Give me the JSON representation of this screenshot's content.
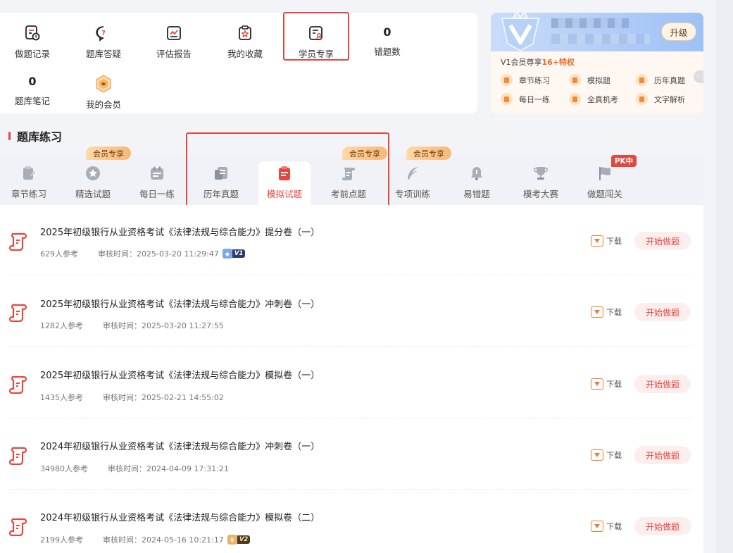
{
  "tools": {
    "wrong_records": "做题记录",
    "qa": "题库答疑",
    "report": "评估报告",
    "favorites": "我的收藏",
    "student_exclusive": "学员专享",
    "wrong_count_value": "0",
    "wrong_count_label": "错题数",
    "notes_count_value": "0",
    "notes_label": "题库笔记",
    "my_member": "我的会员"
  },
  "vip": {
    "upgrade": "升级",
    "title_prefix": "V1会员尊享",
    "title_highlight": "16+特权",
    "features": [
      "章节练习",
      "模拟题",
      "历年真题",
      "每日一练",
      "全真机考",
      "文字解析"
    ]
  },
  "section_title": "题库练习",
  "tabs": [
    {
      "label": "章节练习"
    },
    {
      "label": "精选试题",
      "badge": "会员专享"
    },
    {
      "label": "每日一练"
    },
    {
      "label": "历年真题"
    },
    {
      "label": "模拟试题"
    },
    {
      "label": "考前点题",
      "badge": "会员专享"
    },
    {
      "label": "专项训练",
      "badge": "会员专享"
    },
    {
      "label": "易错题"
    },
    {
      "label": "模考大赛"
    },
    {
      "label": "做题闯关",
      "badge": "PK中"
    }
  ],
  "list": [
    {
      "title": "2025年初级银行从业资格考试《法律法规与综合能力》提分卷（一）",
      "participants": "629人参考",
      "review_time": "审核时间：2025-03-20 11:29:47",
      "vip_tag": "V1",
      "download": "下载",
      "start": "开始做题"
    },
    {
      "title": "2025年初级银行从业资格考试《法律法规与综合能力》冲刺卷（一）",
      "participants": "1282人参考",
      "review_time": "审核时间：2025-03-20 11:27:55",
      "download": "下载",
      "start": "开始做题"
    },
    {
      "title": "2025年初级银行从业资格考试《法律法规与综合能力》模拟卷（一）",
      "participants": "1435人参考",
      "review_time": "审核时间：2025-02-21 14:55:02",
      "download": "下载",
      "start": "开始做题"
    },
    {
      "title": "2024年初级银行从业资格考试《法律法规与综合能力》冲刺卷（一）",
      "participants": "34980人参考",
      "review_time": "审核时间：2024-04-09 17:31:21",
      "download": "下载",
      "start": "开始做题"
    },
    {
      "title": "2024年初级银行从业资格考试《法律法规与综合能力》模拟卷（二）",
      "participants": "2199人参考",
      "review_time": "审核时间：2024-05-16 10:21:17",
      "vip_tag": "V2",
      "download": "下载",
      "start": "开始做题"
    }
  ],
  "colors": {
    "accent": "#e5473f",
    "vip_orange": "#f06a2c"
  }
}
